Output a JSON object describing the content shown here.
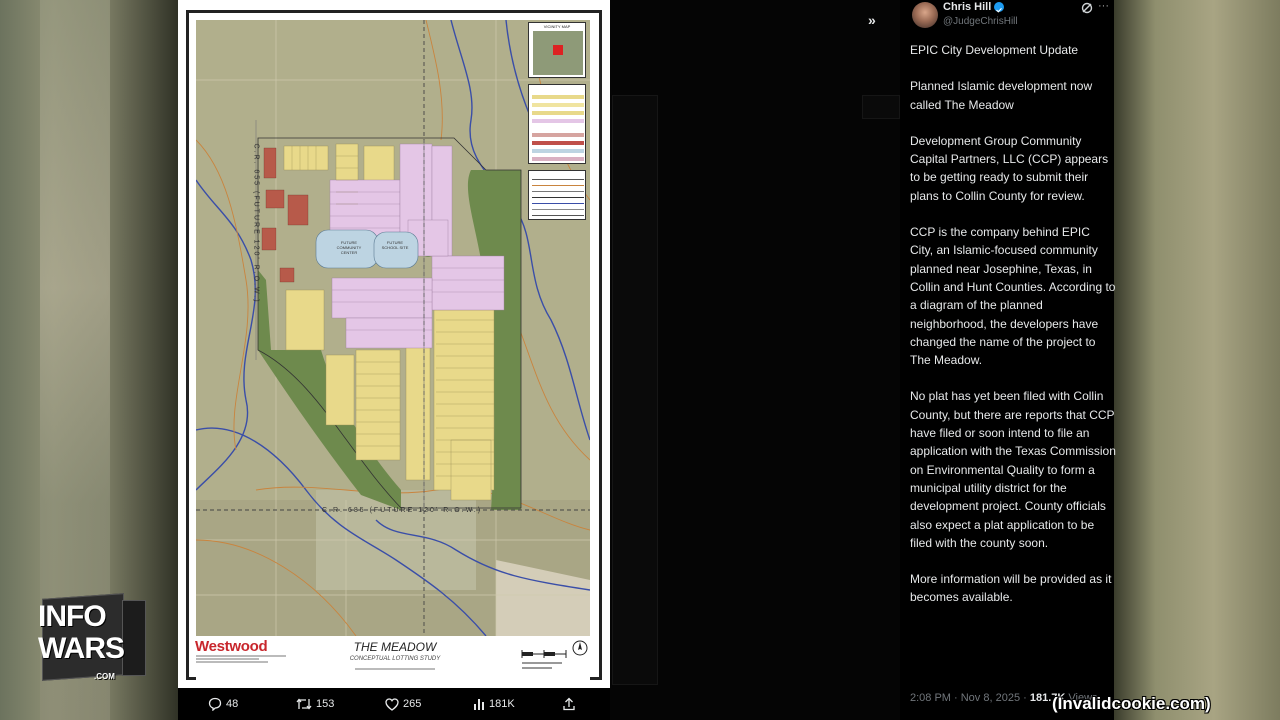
{
  "post": {
    "author_name": "Chris Hill",
    "author_handle": "@JudgeChrisHill",
    "paragraphs": [
      "EPIC City Development Update",
      "Planned Islamic development now called The Meadow",
      "Development Group Community Capital Partners, LLC (CCP) appears to be getting ready to submit their plans to Collin County for review.",
      "CCP is the company behind EPIC City, an Islamic-focused community planned near Josephine, Texas, in Collin and Hunt Counties. According to a diagram of the planned neighborhood, the developers have changed the name of the project to The Meadow.",
      "No plat has yet been filed with Collin County, but there are reports that CCP have filed or soon intend to file an application with the Texas Commission on Environmental Quality to form a municipal utility district for the development project. County officials also expect a plat application to be filed with the county soon.",
      "More information will be provided as it becomes available."
    ],
    "timestamp": "2:08 PM · Nov 8, 2025",
    "views": "181.7K",
    "views_label": "Views"
  },
  "actions": {
    "replies": "48",
    "reposts": "153",
    "likes": "265",
    "views": "181K"
  },
  "map": {
    "brand": "Westwood",
    "title": "THE MEADOW",
    "subtitle": "CONCEPTUAL LOTTING STUDY",
    "community_center": "FUTURE COMMUNITY CENTER",
    "school_site": "FUTURE SCHOOL SITE",
    "road_vertical": "C.R. 655 (FUTURE 120' R.O.W.)",
    "road_horizontal": "C.R. 685 (FUTURE 120' R.O.W.)",
    "vicinity_label": "VICINITY MAP"
  },
  "overlay": {
    "watermark": "(Invalidcookie.com)"
  },
  "colors": {
    "verified": "#1d9bf0",
    "brand_red": "#c8262c",
    "lot_yellow": "#e8d98a",
    "lot_pink": "#e4c6e6"
  }
}
